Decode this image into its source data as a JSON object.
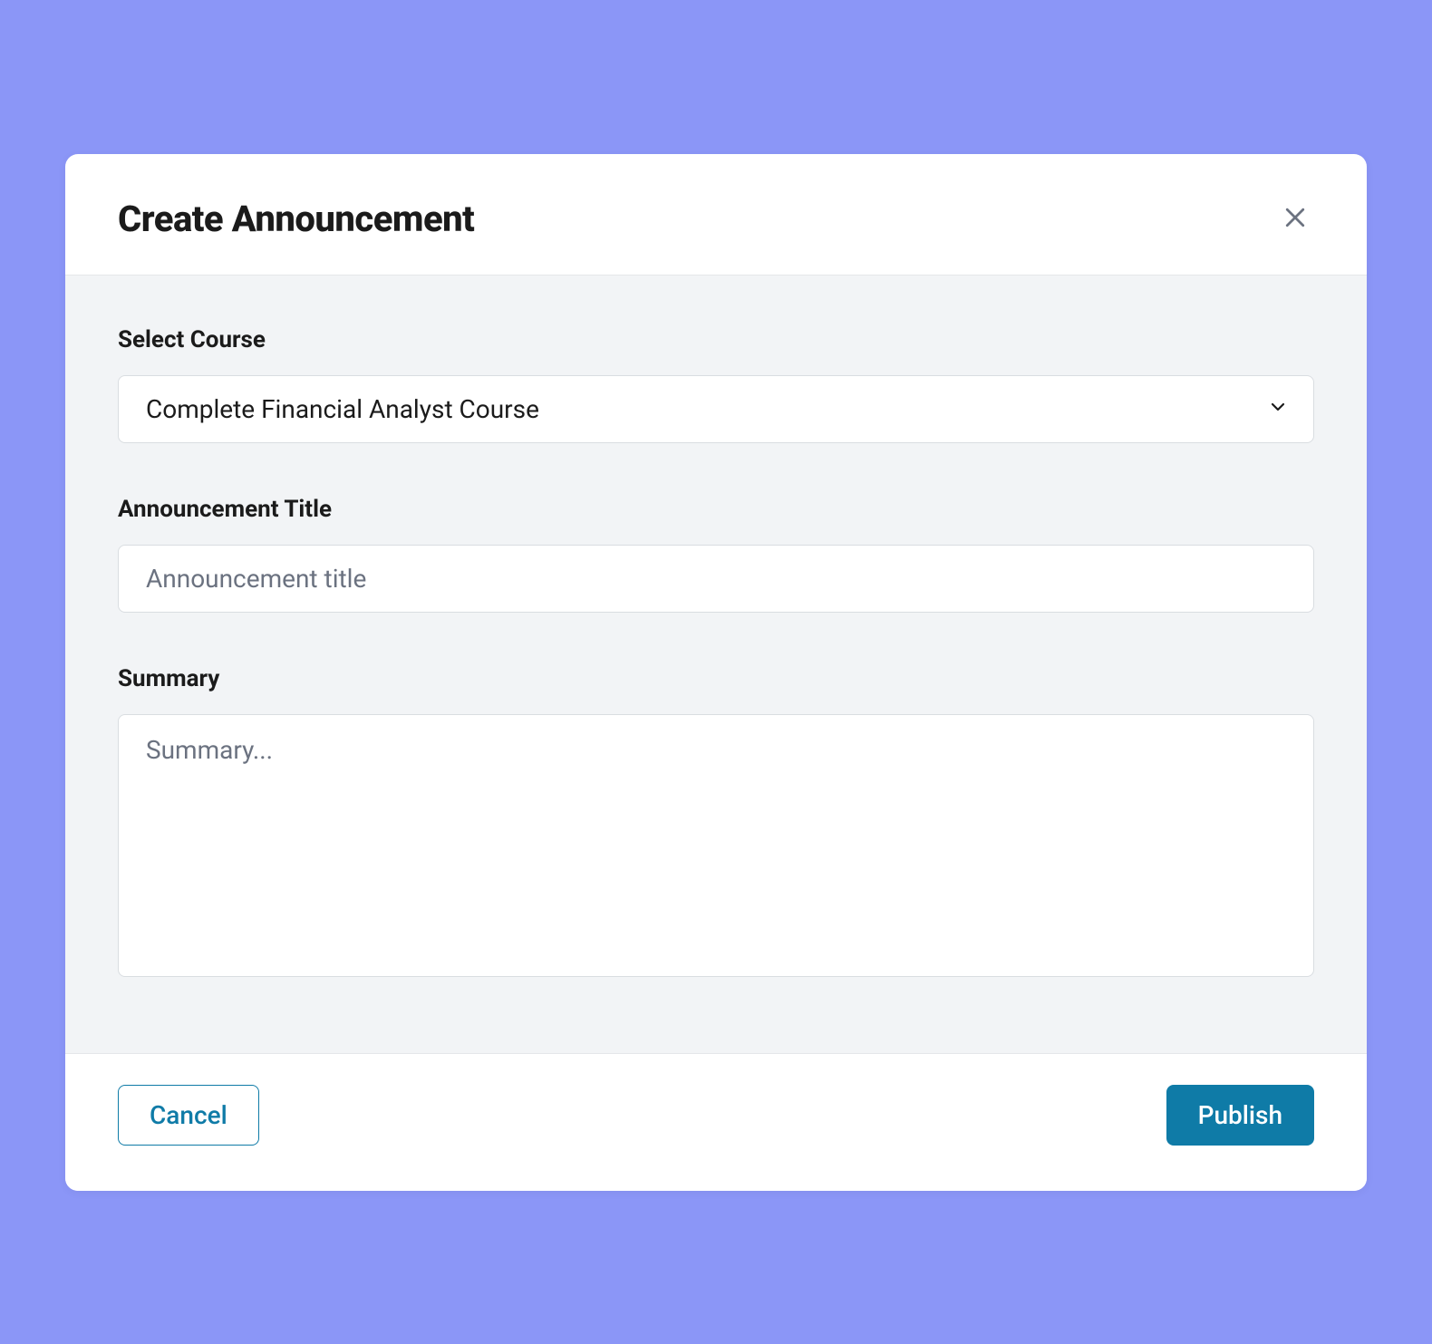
{
  "modal": {
    "title": "Create Announcement"
  },
  "form": {
    "course_label": "Select Course",
    "course_selected": "Complete Financial Analyst Course",
    "title_label": "Announcement Title",
    "title_value": "",
    "title_placeholder": "Announcement title",
    "summary_label": "Summary",
    "summary_value": "",
    "summary_placeholder": "Summary..."
  },
  "footer": {
    "cancel_label": "Cancel",
    "publish_label": "Publish"
  }
}
